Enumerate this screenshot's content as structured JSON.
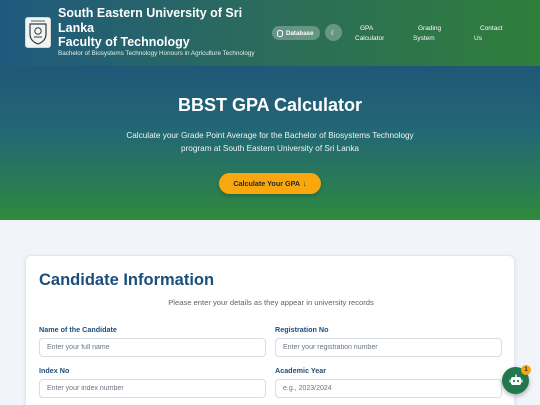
{
  "header": {
    "title_lines": [
      "South Eastern University of Sri",
      "Lanka",
      "Faculty of Technology"
    ],
    "subtitle": "Bachelor of Biosystems Technology Honours in Agriculture Technology",
    "logo_icon": "university-crest-icon",
    "database_label": "Database",
    "theme_icon": "moon-icon",
    "nav": [
      {
        "lines": [
          "GPA",
          "Calculator"
        ]
      },
      {
        "lines": [
          "Grading",
          "System"
        ]
      },
      {
        "lines": [
          "Contact",
          "Us"
        ]
      }
    ]
  },
  "hero": {
    "title": "BBST GPA Calculator",
    "description_lines": [
      "Calculate your Grade Point Average for the Bachelor of Biosystems Technology",
      "program at South Eastern University of Sri Lanka"
    ],
    "cta_label": "Calculate Your GPA",
    "cta_icon": "arrow-down-icon"
  },
  "candidate": {
    "title": "Candidate Information",
    "subtitle": "Please enter your details as they appear in university records",
    "fields": {
      "name": {
        "label": "Name of the Candidate",
        "placeholder": "Enter your full name",
        "value": ""
      },
      "registration": {
        "label": "Registration No",
        "placeholder": "Enter your registration number",
        "value": ""
      },
      "index": {
        "label": "Index No",
        "placeholder": "Enter your index number",
        "value": ""
      },
      "year": {
        "label": "Academic Year",
        "placeholder": "e.g., 2023/2024",
        "value": ""
      }
    }
  },
  "chatbot": {
    "icon": "robot-icon",
    "badge": "1"
  },
  "colors": {
    "header_start": "#1f5a7e",
    "header_end": "#2f7e3b",
    "accent": "#f8a70e",
    "heading": "#1c4e7c",
    "chatbot": "#22774f"
  }
}
